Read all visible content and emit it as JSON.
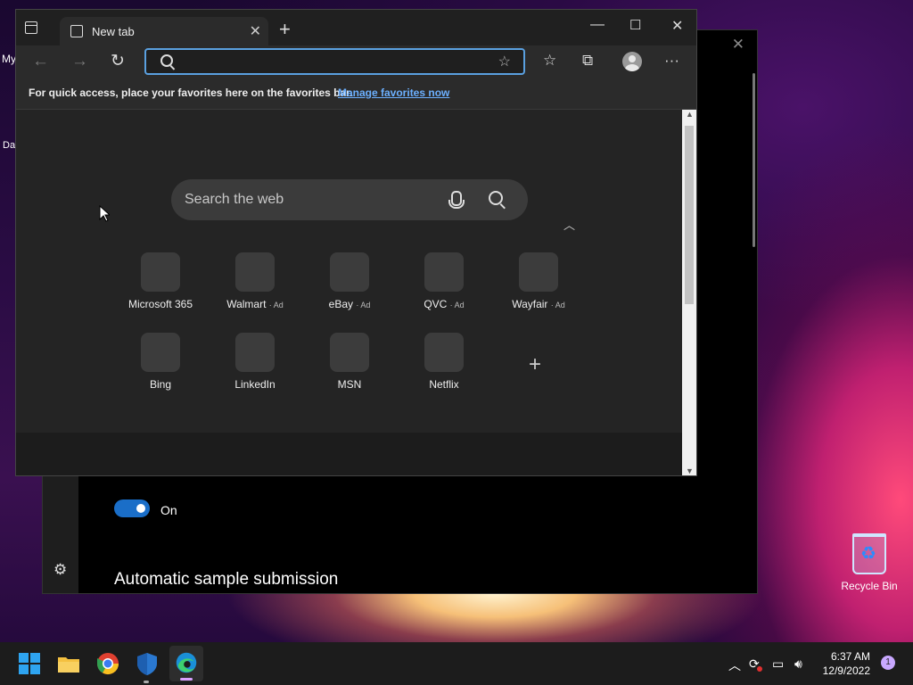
{
  "desktop": {
    "icon_partial_1": "My",
    "icon_partial_2": "Da",
    "recycle_bin": "Recycle Bin"
  },
  "security_window": {
    "toggle_label": "On",
    "heading": "Automatic sample submission"
  },
  "browser": {
    "tab_title": "New tab",
    "favorites_message": "For quick access, place your favorites here on the favorites bar.",
    "favorites_link": "Manage favorites now",
    "search_placeholder": "Search the web",
    "quick_links": [
      {
        "name": "Microsoft 365",
        "ad": ""
      },
      {
        "name": "Walmart",
        "ad": "· Ad"
      },
      {
        "name": "eBay",
        "ad": "· Ad"
      },
      {
        "name": "QVC",
        "ad": "· Ad"
      },
      {
        "name": "Wayfair",
        "ad": "· Ad"
      },
      {
        "name": "Bing",
        "ad": ""
      },
      {
        "name": "LinkedIn",
        "ad": ""
      },
      {
        "name": "MSN",
        "ad": ""
      },
      {
        "name": "Netflix",
        "ad": ""
      }
    ]
  },
  "taskbar": {
    "time": "6:37 AM",
    "date": "12/9/2022",
    "notification_count": "1",
    "accent": "#1a6ec8"
  }
}
